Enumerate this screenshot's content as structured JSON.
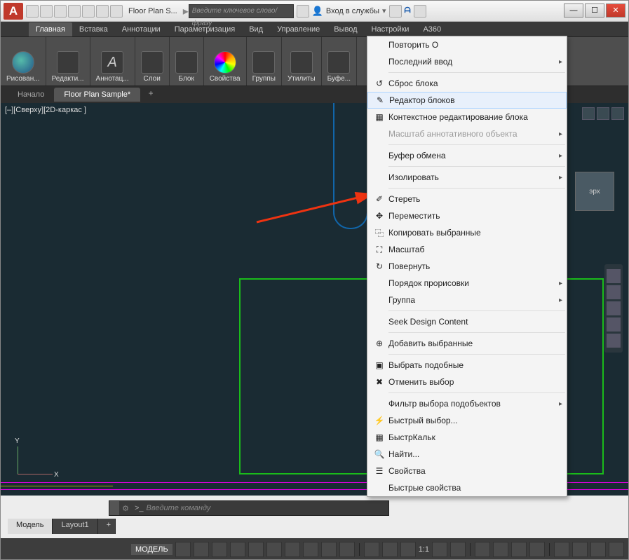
{
  "title_doc": "Floor Plan S...",
  "search_placeholder": "Введите ключевое слово/фразу",
  "signin_label": "Вход в службы",
  "ribbon_tabs": [
    "Главная",
    "Вставка",
    "Аннотации",
    "Параметризация",
    "Вид",
    "Управление",
    "Вывод",
    "Настройки",
    "A360"
  ],
  "ribbon_active": 0,
  "panels": {
    "draw": "Рисован...",
    "edit": "Редакти...",
    "annot": "Аннотац...",
    "layers": "Слои",
    "block": "Блок",
    "props": "Свойства",
    "groups": "Группы",
    "utils": "Утилиты",
    "buf": "Буфе..."
  },
  "doc_tabs": {
    "start": "Начало",
    "file": "Floor Plan Sample*"
  },
  "viewport_label": "[–][Сверху][2D-каркас ]",
  "ucs": {
    "x": "X",
    "y": "Y"
  },
  "nav_cube_face": "эрх",
  "ctx": {
    "repeat": "Повторить О",
    "last_input": "Последний ввод",
    "reset_block": "Сброс блока",
    "block_editor": "Редактор блоков",
    "edit_in_place": "Контекстное редактирование блока",
    "annot_scale": "Масштаб аннотативного объекта",
    "clipboard": "Буфер обмена",
    "isolate": "Изолировать",
    "erase": "Стереть",
    "move": "Переместить",
    "copy_sel": "Копировать выбранные",
    "scale": "Масштаб",
    "rotate": "Повернуть",
    "draw_order": "Порядок прорисовки",
    "group": "Группа",
    "seek": "Seek Design Content",
    "add_sel": "Добавить выбранные",
    "sel_similar": "Выбрать подобные",
    "deselect": "Отменить выбор",
    "subobj_filter": "Фильтр выбора подобъектов",
    "quick_select": "Быстрый выбор...",
    "quickcalc": "БыстрКальк",
    "find": "Найти...",
    "properties": "Свойства",
    "quick_props": "Быстрые свойства"
  },
  "cmd": {
    "prompt": ">_",
    "hint": "Введите команду"
  },
  "model_tabs": {
    "model": "Модель",
    "layout1": "Layout1"
  },
  "status": {
    "model": "МОДЕЛЬ",
    "scale": "1:1"
  },
  "winbtns": {
    "min": "—",
    "max": "☐",
    "close": "✕"
  }
}
